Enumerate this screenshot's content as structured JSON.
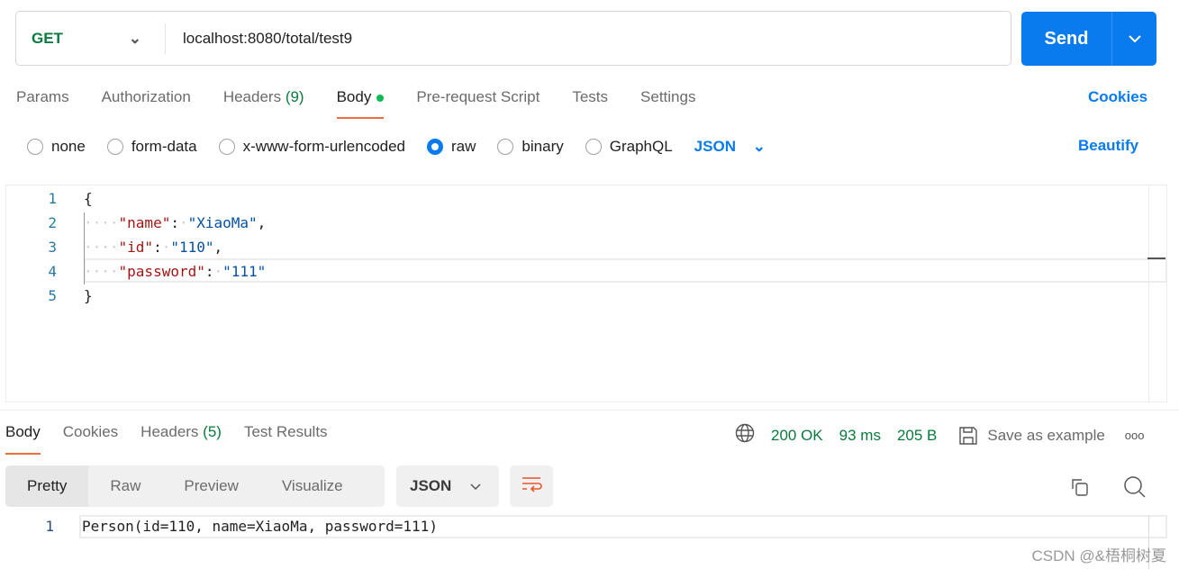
{
  "request": {
    "method": "GET",
    "url": "localhost:8080/total/test9",
    "send_label": "Send"
  },
  "tabs": [
    {
      "label": "Params"
    },
    {
      "label": "Authorization"
    },
    {
      "label": "Headers",
      "count": "(9)"
    },
    {
      "label": "Body"
    },
    {
      "label": "Pre-request Script"
    },
    {
      "label": "Tests"
    },
    {
      "label": "Settings"
    }
  ],
  "cookies_label": "Cookies",
  "body_types": [
    "none",
    "form-data",
    "x-www-form-urlencoded",
    "raw",
    "binary",
    "GraphQL"
  ],
  "selected_body_type": "raw",
  "format": "JSON",
  "beautify_label": "Beautify",
  "editor": {
    "lines": [
      "1",
      "2",
      "3",
      "4",
      "5"
    ],
    "open": "{",
    "close": "}",
    "k1": "\"name\"",
    "v1": "\"XiaoMa\"",
    "k2": "\"id\"",
    "v2": "\"110\"",
    "k3": "\"password\"",
    "v3": "\"111\""
  },
  "response": {
    "tabs": [
      {
        "label": "Body"
      },
      {
        "label": "Cookies"
      },
      {
        "label": "Headers",
        "count": "(5)"
      },
      {
        "label": "Test Results"
      }
    ],
    "status": "200 OK",
    "time": "93 ms",
    "size": "205 B",
    "save_label": "Save as example",
    "more": "ooo",
    "views": [
      "Pretty",
      "Raw",
      "Preview",
      "Visualize"
    ],
    "format": "JSON",
    "line": "1",
    "body": "Person(id=110, name=XiaoMa, password=111)"
  },
  "watermark": "CSDN @&梧桐树夏",
  "colors": {
    "accent": "#097bed",
    "success": "#0b7a3e",
    "tab_underline": "#f26b3a"
  }
}
